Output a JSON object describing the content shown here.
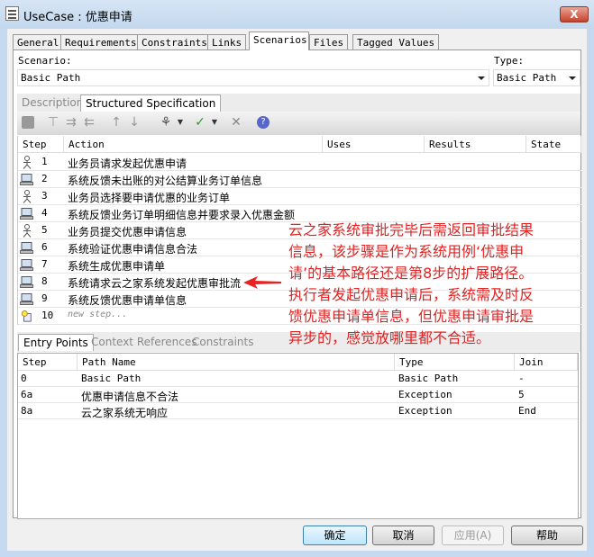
{
  "window": {
    "title": "UseCase : 优惠申请",
    "close": "X"
  },
  "tabs": [
    "General",
    "Requirements",
    "Constraints",
    "Links",
    "Scenarios",
    "Files",
    "Tagged Values"
  ],
  "scenario": {
    "label": "Scenario:",
    "value": "Basic Path",
    "type_label": "Type:",
    "type_value": "Basic Path"
  },
  "subtabs": [
    "Description",
    "Structured Specification"
  ],
  "steps": {
    "columns": [
      "Step",
      "Action",
      "Uses",
      "Results",
      "State"
    ],
    "rows": [
      {
        "icon": "actor",
        "step": "1",
        "action": "业务员请求发起优惠申请"
      },
      {
        "icon": "system",
        "step": "2",
        "action": "系统反馈未出账的对公结算业务订单信息"
      },
      {
        "icon": "actor",
        "step": "3",
        "action": "业务员选择要申请优惠的业务订单"
      },
      {
        "icon": "system",
        "step": "4",
        "action": "系统反馈业务订单明细信息并要求录入优惠金额"
      },
      {
        "icon": "actor",
        "step": "5",
        "action": "业务员提交优惠申请信息"
      },
      {
        "icon": "system",
        "step": "6",
        "action": "系统验证优惠申请信息合法"
      },
      {
        "icon": "system",
        "step": "7",
        "action": "系统生成优惠申请单"
      },
      {
        "icon": "system",
        "step": "8",
        "action": "系统请求云之家系统发起优惠审批流"
      },
      {
        "icon": "system",
        "step": "9",
        "action": "系统反馈优惠申请单信息"
      },
      {
        "icon": "new",
        "step": "10",
        "action": "new step..."
      }
    ]
  },
  "bottom_tabs": [
    "Entry Points",
    "Context References",
    "Constraints"
  ],
  "entry_points": {
    "columns": [
      "Step",
      "Path Name",
      "Type",
      "Join"
    ],
    "rows": [
      {
        "step": "0",
        "name": "Basic Path",
        "type": "Basic Path",
        "join": "-"
      },
      {
        "step": "6a",
        "name": "优惠申请信息不合法",
        "type": "Exception",
        "join": "5"
      },
      {
        "step": "8a",
        "name": "云之家系统无响应",
        "type": "Exception",
        "join": "End"
      }
    ]
  },
  "annotation": "云之家系统审批完毕后需返回审批结果\n信息，该步骤是作为系统用例‘优惠申\n请’的基本路径还是第8步的扩展路径。\n执行者发起优惠申请后，系统需及时反\n馈优惠申请单信息，但优惠申请审批是\n异步的，感觉放哪里都不合适。",
  "buttons": {
    "ok": "确定",
    "cancel": "取消",
    "apply": "应用(A)",
    "help": "帮助"
  },
  "colors": {
    "annotation": "#e02222"
  }
}
